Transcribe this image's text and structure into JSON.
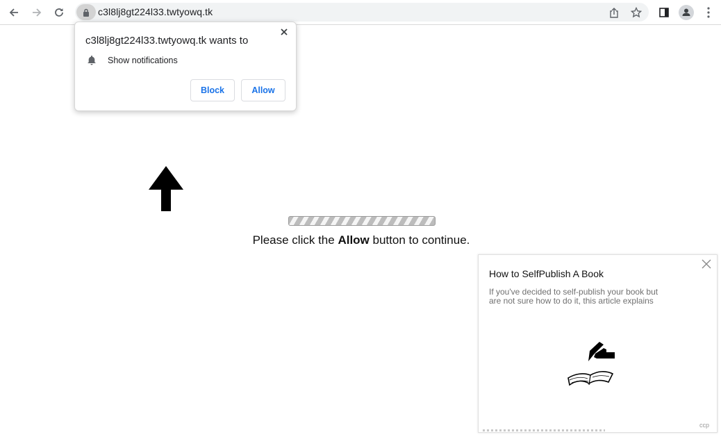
{
  "browser": {
    "url": "c3l8lj8gt224l33.twtyowq.tk",
    "icons": {
      "back": "arrow-left-icon",
      "forward": "arrow-right-icon",
      "reload": "reload-icon",
      "lock": "lock-icon",
      "share": "share-icon",
      "bookmark": "star-icon",
      "side_panel": "side-panel-icon",
      "profile": "profile-avatar-icon",
      "menu": "kebab-menu-icon"
    }
  },
  "permission_prompt": {
    "title": "c3l8lj8gt224l33.twtyowq.tk wants to",
    "permission": "Show notifications",
    "block_label": "Block",
    "allow_label": "Allow",
    "accent_color": "#1a73e8"
  },
  "page": {
    "message_before": "Please click the ",
    "message_bold": "Allow",
    "message_after": " button to continue."
  },
  "ad": {
    "title": "How to SelfPublish A Book",
    "description": "If you've decided to self-publish your book but are not sure how to do it, this article explains",
    "sponsor": "ccp"
  }
}
